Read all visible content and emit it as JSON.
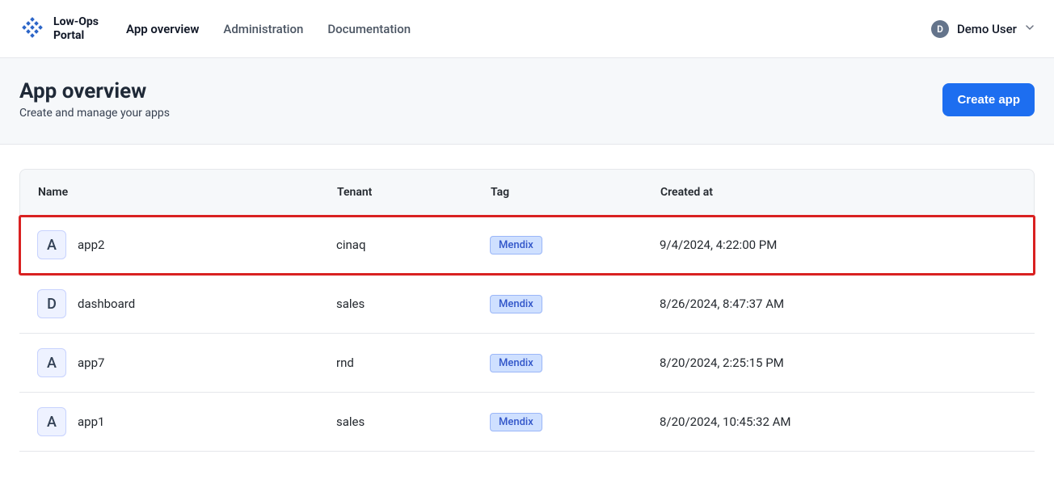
{
  "brand": {
    "line1": "Low-Ops",
    "line2": "Portal"
  },
  "nav": {
    "items": [
      {
        "label": "App overview",
        "active": true
      },
      {
        "label": "Administration",
        "active": false
      },
      {
        "label": "Documentation",
        "active": false
      }
    ]
  },
  "user": {
    "initial": "D",
    "name": "Demo User"
  },
  "page": {
    "title": "App overview",
    "subtitle": "Create and manage your apps",
    "primary_action": "Create app"
  },
  "table": {
    "headers": {
      "name": "Name",
      "tenant": "Tenant",
      "tag": "Tag",
      "created": "Created at"
    },
    "rows": [
      {
        "icon": "A",
        "name": "app2",
        "tenant": "cinaq",
        "tag": "Mendix",
        "created": "9/4/2024, 4:22:00 PM",
        "highlight": true
      },
      {
        "icon": "D",
        "name": "dashboard",
        "tenant": "sales",
        "tag": "Mendix",
        "created": "8/26/2024, 8:47:37 AM",
        "highlight": false
      },
      {
        "icon": "A",
        "name": "app7",
        "tenant": "rnd",
        "tag": "Mendix",
        "created": "8/20/2024, 2:25:15 PM",
        "highlight": false
      },
      {
        "icon": "A",
        "name": "app1",
        "tenant": "sales",
        "tag": "Mendix",
        "created": "8/20/2024, 10:45:32 AM",
        "highlight": false
      }
    ]
  }
}
